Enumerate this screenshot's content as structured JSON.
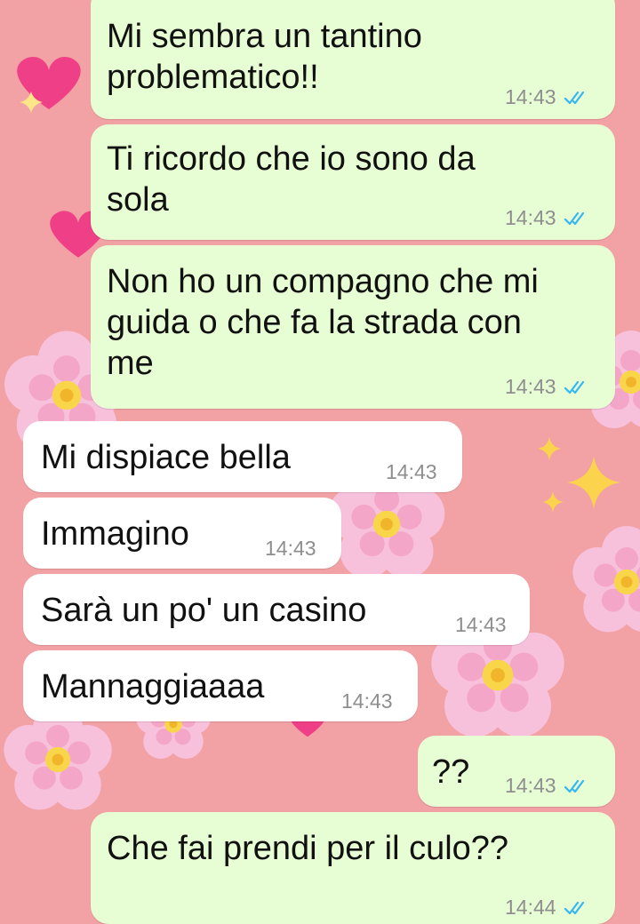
{
  "theme": {
    "wallpaper": "#f2a1a4",
    "outgoing_bubble": "#e7fdd4",
    "incoming_bubble": "#ffffff",
    "read_ticks": "#34b7f1"
  },
  "wallpaper_icons": [
    "sparkling-heart-icon",
    "pink-heart-icon",
    "cherry-blossom-icon",
    "sparkles-icon"
  ],
  "messages": [
    {
      "direction": "outgoing",
      "text": "Mi sembra un tantino\nproblematico!!",
      "time": "14:43",
      "status_icon": "double-check-read-icon"
    },
    {
      "direction": "outgoing",
      "text": "Ti ricordo che io sono da\nsola",
      "time": "14:43",
      "status_icon": "double-check-read-icon"
    },
    {
      "direction": "outgoing",
      "text": "Non ho un compagno che mi\nguida o che fa la strada con\nme",
      "time": "14:43",
      "status_icon": "double-check-read-icon"
    },
    {
      "direction": "incoming",
      "text": "Mi dispiace bella",
      "time": "14:43"
    },
    {
      "direction": "incoming",
      "text": "Immagino",
      "time": "14:43"
    },
    {
      "direction": "incoming",
      "text": "Sarà un po' un casino",
      "time": "14:43"
    },
    {
      "direction": "incoming",
      "text": "Mannaggiaaaa",
      "time": "14:43"
    },
    {
      "direction": "outgoing",
      "text": "??",
      "time": "14:43",
      "status_icon": "double-check-read-icon"
    },
    {
      "direction": "outgoing",
      "text": "Che fai prendi per il culo??",
      "time": "14:44",
      "status_icon": "double-check-read-icon"
    }
  ]
}
